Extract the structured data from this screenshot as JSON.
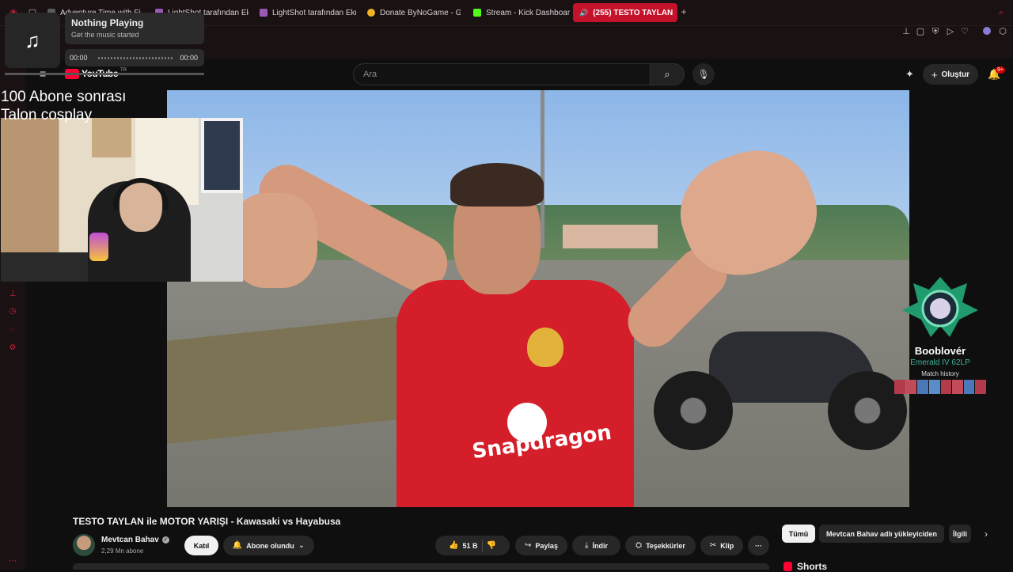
{
  "browser": {
    "tabs": [
      {
        "label": "Adventure Time with Finn",
        "favicon_color": "#5a5a5a",
        "active": false
      },
      {
        "label": "LightShot tarafından Ekra",
        "favicon_color": "#9b59b6",
        "active": false
      },
      {
        "label": "LightShot tarafından Ekra",
        "favicon_color": "#9b59b6",
        "active": false
      },
      {
        "label": "Donate ByNoGame - Gele",
        "favicon_color": "#f0b429",
        "active": false
      },
      {
        "label": "Stream - Kick Dashboard",
        "favicon_color": "#53fc18",
        "active": false
      },
      {
        "label": "(255) TESTO TAYLAN",
        "favicon_color": "#ffffff",
        "active": true
      }
    ],
    "new_tab_label": "+",
    "toolbar_icons": [
      "pin-icon",
      "sidebar-icon",
      "shield-icon",
      "media-icon",
      "heart-icon",
      "extension-icon"
    ]
  },
  "media_popup": {
    "title": "Nothing Playing",
    "subtitle": "Get the music started",
    "time_start": "00:00",
    "time_end": "00:00",
    "icon": "music-note-icon"
  },
  "youtube": {
    "logo_text": "YouTube",
    "logo_sup": "TR",
    "search_placeholder": "Ara",
    "create_label": "Oluştur",
    "notification_count": "9+"
  },
  "stream_overlay": {
    "line1": "100 Abone sonrası",
    "line2": "Talon cosplay"
  },
  "lol_overlay": {
    "summoner": "Booblovér",
    "rank": "Emerald IV 62LP",
    "history_label": "Match history",
    "match_colors": [
      "#b33a4a",
      "#c24b5a",
      "#4a78b8",
      "#5b8cc9",
      "#b33a4a",
      "#c24b5a",
      "#4a78b8",
      "#b33a4a"
    ]
  },
  "video": {
    "title": "TESTO TAYLAN ile MOTOR YARIŞI - Kawasaki vs Hayabusa",
    "channel_name": "Mevtcan Bahav",
    "channel_subs": "2,29 Mn abone",
    "join_label": "Katıl",
    "subscribed_label": "Abone olundu",
    "like_count": "51 B",
    "share_label": "Paylaş",
    "download_label": "İndir",
    "thanks_label": "Teşekkürler",
    "clip_label": "Klip",
    "more_label": "···",
    "shirt_text": "Snapdragon"
  },
  "related": {
    "chips": [
      "Tümü",
      "Mevtcan Bahav adlı yükleyiciden",
      "İlgili"
    ],
    "shorts_heading": "Shorts"
  }
}
